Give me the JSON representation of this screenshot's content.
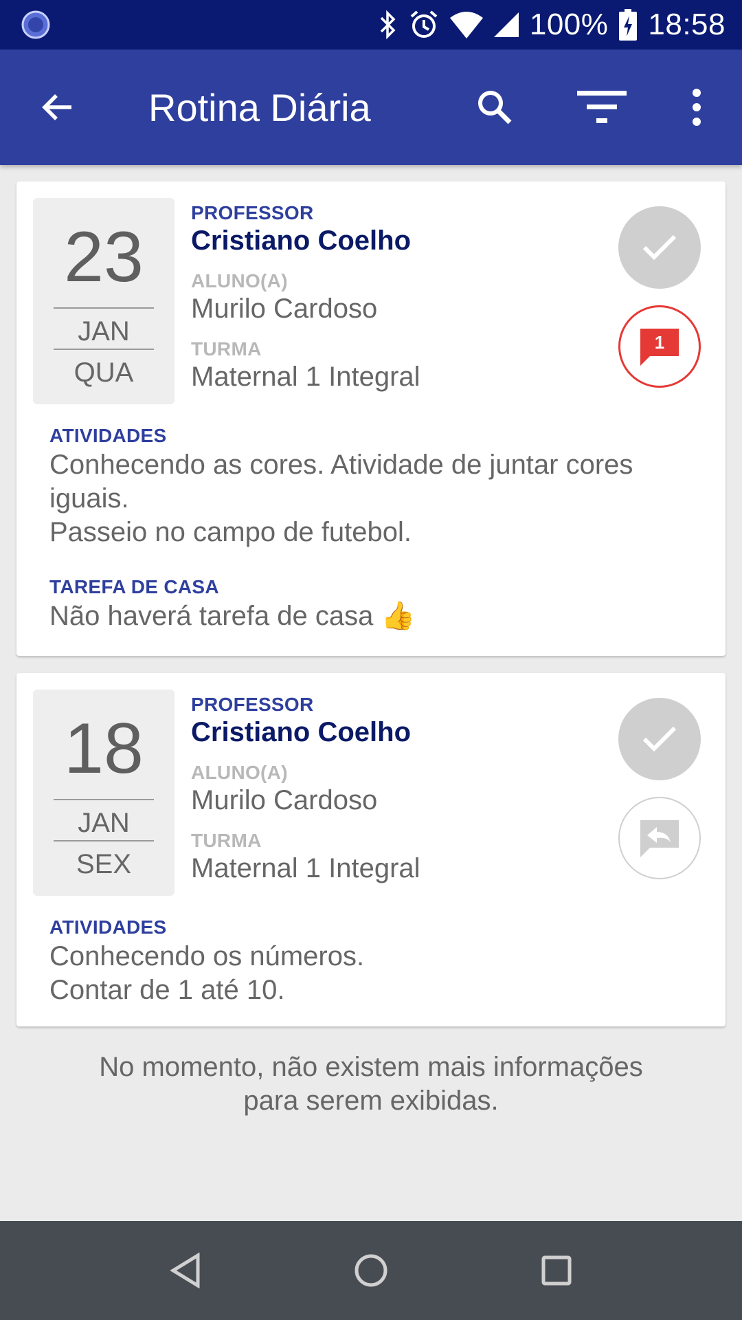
{
  "status_bar": {
    "battery": "100%",
    "time": "18:58",
    "icons": [
      "app-notification-icon",
      "bluetooth-icon",
      "alarm-icon",
      "wifi-icon",
      "signal-icon",
      "battery-charging-icon"
    ]
  },
  "app_bar": {
    "title": "Rotina Diária",
    "icons": [
      "back-arrow-icon",
      "search-icon",
      "filter-icon",
      "more-vert-icon"
    ]
  },
  "entries": [
    {
      "day": "23",
      "month": "JAN",
      "weekday": "QUA",
      "professor_label": "PROFESSOR",
      "professor": "Cristiano Coelho",
      "student_label": "ALUNO(A)",
      "student": "Murilo Cardoso",
      "class_label": "TURMA",
      "class_name": "Maternal 1 Integral",
      "activities_label": "ATIVIDADES",
      "activities": [
        "Conhecendo as cores. Atividade de juntar cores iguais.",
        "Passeio no campo de futebol."
      ],
      "homework_label": "TAREFA DE CASA",
      "homework": "Não haverá tarefa de casa 👍",
      "message_count": "1"
    },
    {
      "day": "18",
      "month": "JAN",
      "weekday": "SEX",
      "professor_label": "PROFESSOR",
      "professor": "Cristiano Coelho",
      "student_label": "ALUNO(A)",
      "student": "Murilo Cardoso",
      "class_label": "TURMA",
      "class_name": "Maternal 1 Integral",
      "activities_label": "ATIVIDADES",
      "activities": [
        "Conhecendo os números.",
        "Contar de 1 até 10."
      ]
    }
  ],
  "empty_message": "No momento, não existem mais informações para serem exibidas.",
  "colors": {
    "status_bar": "#0a1a72",
    "app_bar": "#2f3f9e",
    "accent_blue": "#2f3f9e",
    "name_blue": "#0b1a66",
    "alert_red": "#e53935",
    "nav_bar": "#474b52"
  }
}
